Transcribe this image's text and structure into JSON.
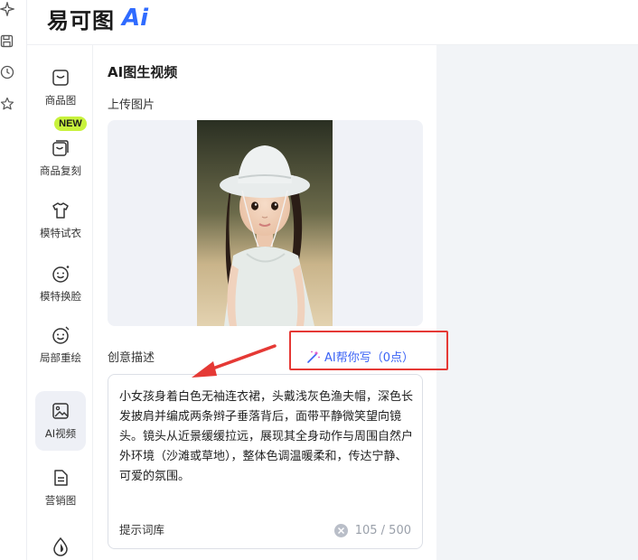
{
  "app": {
    "logo_text": "易可图",
    "logo_ai": "Ai"
  },
  "left_strip": {
    "icons": [
      "sparkle-icon",
      "save-icon",
      "history-icon",
      "star-icon"
    ]
  },
  "sidenav": {
    "items": [
      {
        "label": "商品图",
        "icon": "product-image-icon",
        "active": false
      },
      {
        "label": "商品复刻",
        "icon": "product-copy-icon",
        "active": false,
        "badge": "NEW"
      },
      {
        "label": "模特试衣",
        "icon": "tshirt-icon",
        "active": false
      },
      {
        "label": "模特换脸",
        "icon": "face-swap-icon",
        "active": false
      },
      {
        "label": "局部重绘",
        "icon": "partial-redraw-icon",
        "active": false
      },
      {
        "label": "AI视频",
        "icon": "ai-video-icon",
        "active": true
      },
      {
        "label": "营销图",
        "icon": "marketing-image-icon",
        "active": false
      },
      {
        "label": "",
        "icon": "drop-icon",
        "active": false
      }
    ]
  },
  "panel": {
    "title": "AI图生视频",
    "upload_label": "上传图片",
    "description_label": "创意描述",
    "ai_help_label": "AI帮你写（0点）",
    "description_text": "小女孩身着白色无袖连衣裙，头戴浅灰色渔夫帽，深色长发披肩并编成两条辫子垂落背后，面带平静微笑望向镜头。镜头从近景缓缓拉远，展现其全身动作与周围自然户外环境（沙滩或草地），整体色调温暖柔和，传达宁静、可爱的氛围。",
    "prompt_library_label": "提示词库",
    "char_count": "105 / 500"
  },
  "colors": {
    "accent": "#3b63f5",
    "badge_green": "#c8f23c",
    "annotation_red": "#e53935",
    "active_nav_bg": "#eef0f6"
  }
}
